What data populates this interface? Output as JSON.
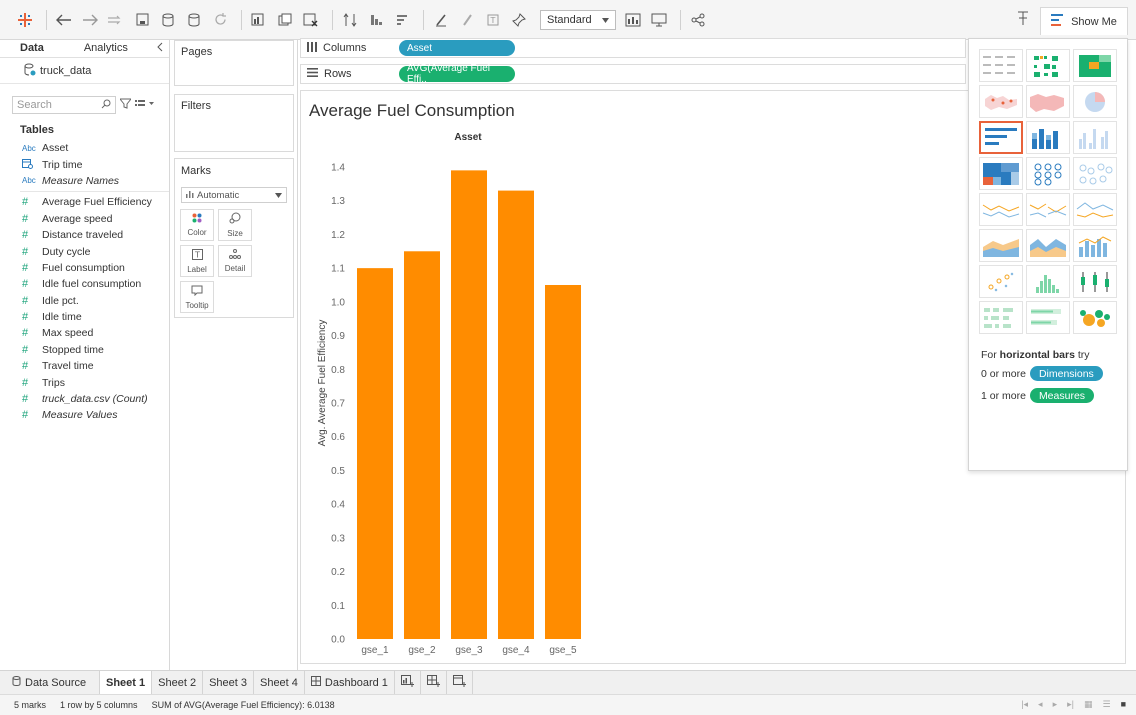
{
  "toolbar": {
    "view_mode": "Standard",
    "show_me_label": "Show Me"
  },
  "data_pane": {
    "tab_data": "Data",
    "tab_analytics": "Analytics",
    "datasource": "truck_data",
    "search_placeholder": "Search",
    "tables_heading": "Tables",
    "dimensions": [
      {
        "icon": "Abc",
        "label": "Asset",
        "italic": false
      },
      {
        "icon": "date",
        "label": "Trip time",
        "italic": false
      },
      {
        "icon": "Abc",
        "label": "Measure Names",
        "italic": true
      }
    ],
    "measures": [
      {
        "label": "Average Fuel Efficiency",
        "italic": false
      },
      {
        "label": "Average speed",
        "italic": false
      },
      {
        "label": "Distance traveled",
        "italic": false
      },
      {
        "label": "Duty cycle",
        "italic": false
      },
      {
        "label": "Fuel consumption",
        "italic": false
      },
      {
        "label": "Idle fuel consumption",
        "italic": false
      },
      {
        "label": "Idle pct.",
        "italic": false
      },
      {
        "label": "Idle time",
        "italic": false
      },
      {
        "label": "Max speed",
        "italic": false
      },
      {
        "label": "Stopped time",
        "italic": false
      },
      {
        "label": "Travel time",
        "italic": false
      },
      {
        "label": "Trips",
        "italic": false
      },
      {
        "label": "truck_data.csv (Count)",
        "italic": true
      },
      {
        "label": "Measure Values",
        "italic": true
      }
    ]
  },
  "cards": {
    "pages": "Pages",
    "filters": "Filters",
    "marks": "Marks",
    "marks_type": "Automatic",
    "mark_buttons": [
      "Color",
      "Size",
      "Label",
      "Detail",
      "Tooltip"
    ]
  },
  "shelves": {
    "columns_label": "Columns",
    "columns_pill": "Asset",
    "rows_label": "Rows",
    "rows_pill": "AVG(Average Fuel Effi.."
  },
  "viz": {
    "title": "Average Fuel Consumption"
  },
  "chart_data": {
    "type": "bar",
    "title": "Average Fuel Consumption",
    "column_header": "Asset",
    "categories": [
      "gse_1",
      "gse_2",
      "gse_3",
      "gse_4",
      "gse_5"
    ],
    "values": [
      1.1,
      1.15,
      1.39,
      1.33,
      1.05
    ],
    "ylabel": "Avg. Average Fuel Efficiency",
    "xlabel": "",
    "ylim": [
      0,
      1.4
    ],
    "yticks": [
      "0.0",
      "0.1",
      "0.2",
      "0.3",
      "0.4",
      "0.5",
      "0.6",
      "0.7",
      "0.8",
      "0.9",
      "1.0",
      "1.1",
      "1.2",
      "1.3",
      "1.4"
    ],
    "bar_color": "#ff8c00",
    "grid": false
  },
  "show_me": {
    "hint_prefix": "For ",
    "hint_bold": "horizontal bars",
    "hint_suffix": " try",
    "req1_prefix": "0 or more",
    "req1_pill": "Dimensions",
    "req2_prefix": "1 or more",
    "req2_pill": "Measures",
    "dim_color": "#2a9cbf",
    "meas_color": "#1ab06f"
  },
  "sheet_tabs": {
    "data_source": "Data Source",
    "sheets": [
      "Sheet 1",
      "Sheet 2",
      "Sheet 3",
      "Sheet 4"
    ],
    "dashboard": "Dashboard 1",
    "active": "Sheet 1"
  },
  "status": {
    "marks": "5 marks",
    "dims": "1 row by 5 columns",
    "sum": "SUM of AVG(Average Fuel Efficiency): 6.0138"
  }
}
